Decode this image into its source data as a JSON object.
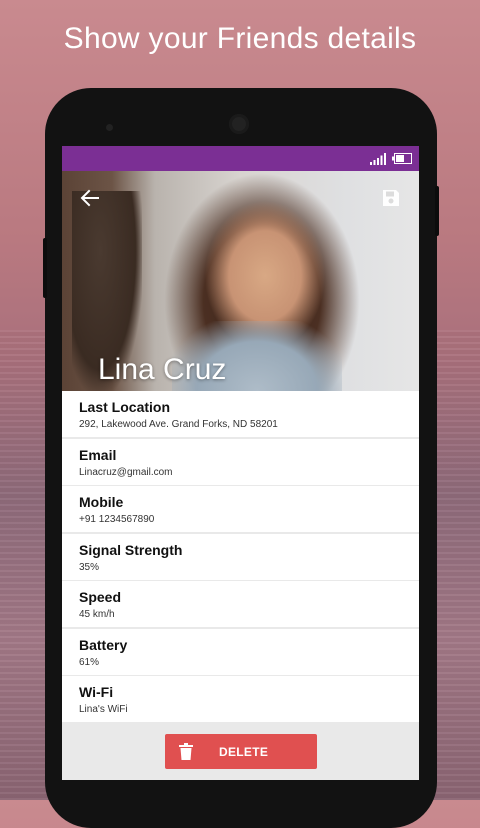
{
  "promo": {
    "headline": "Show your Friends details"
  },
  "contact": {
    "name": "Lina Cruz",
    "fields": [
      {
        "label": "Last Location",
        "value": "292, Lakewood Ave. Grand Forks, ND 58201"
      },
      {
        "label": "Email",
        "value": "Linacruz@gmail.com"
      },
      {
        "label": "Mobile",
        "value": "+91 1234567890"
      },
      {
        "label": "Signal Strength",
        "value": "35%"
      },
      {
        "label": "Speed",
        "value": "45 km/h"
      },
      {
        "label": "Battery",
        "value": "61%"
      },
      {
        "label": "Wi-Fi",
        "value": "Lina's WiFi"
      }
    ]
  },
  "actions": {
    "delete_label": "DELETE"
  },
  "icons": {
    "back": "arrow-left-icon",
    "save": "save-icon",
    "signal": "signal-icon",
    "battery": "battery-icon",
    "trash": "trash-icon"
  },
  "colors": {
    "status_bar": "#7b2f94",
    "delete_button": "#e05050"
  }
}
